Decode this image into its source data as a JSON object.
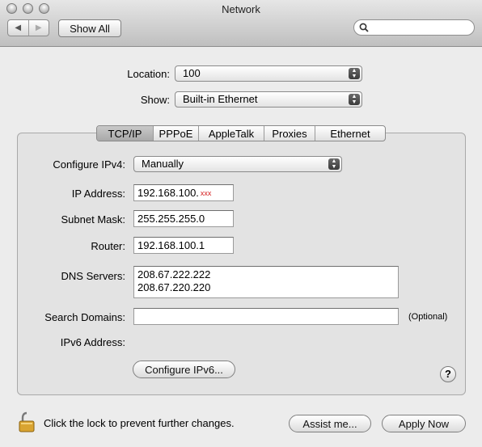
{
  "window": {
    "title": "Network"
  },
  "toolbar": {
    "back_glyph": "◀",
    "forward_glyph": "▶",
    "show_all_label": "Show All",
    "search_placeholder": ""
  },
  "location": {
    "label": "Location:",
    "value": "100"
  },
  "show": {
    "label": "Show:",
    "value": "Built-in Ethernet"
  },
  "tabs": [
    {
      "label": "TCP/IP",
      "active": true
    },
    {
      "label": "PPPoE"
    },
    {
      "label": "AppleTalk"
    },
    {
      "label": "Proxies"
    },
    {
      "label": "Ethernet"
    }
  ],
  "tcpip": {
    "configure_label": "Configure IPv4:",
    "configure_value": "Manually",
    "ip_label": "IP Address:",
    "ip_value": "192.168.100.",
    "ip_redacted": "xxx",
    "subnet_label": "Subnet Mask:",
    "subnet_value": "255.255.255.0",
    "router_label": "Router:",
    "router_value": "192.168.100.1",
    "dns_label": "DNS Servers:",
    "dns_values": [
      "208.67.222.222",
      "208.67.220.220"
    ],
    "search_label": "Search Domains:",
    "search_value": "",
    "optional_note": "(Optional)",
    "ipv6_label": "IPv6 Address:",
    "configure_ipv6_label": "Configure IPv6...",
    "help_glyph": "?"
  },
  "footer": {
    "lock_text": "Click the lock to prevent further changes.",
    "assist_label": "Assist me...",
    "apply_label": "Apply Now"
  },
  "icons": [
    "close-icon",
    "minimize-icon",
    "zoom-icon",
    "search-icon",
    "popup-arrows-icon",
    "help-icon",
    "lock-icon"
  ],
  "colors": {
    "redacted": "#d41b1b",
    "window_bg": "#ececec"
  }
}
